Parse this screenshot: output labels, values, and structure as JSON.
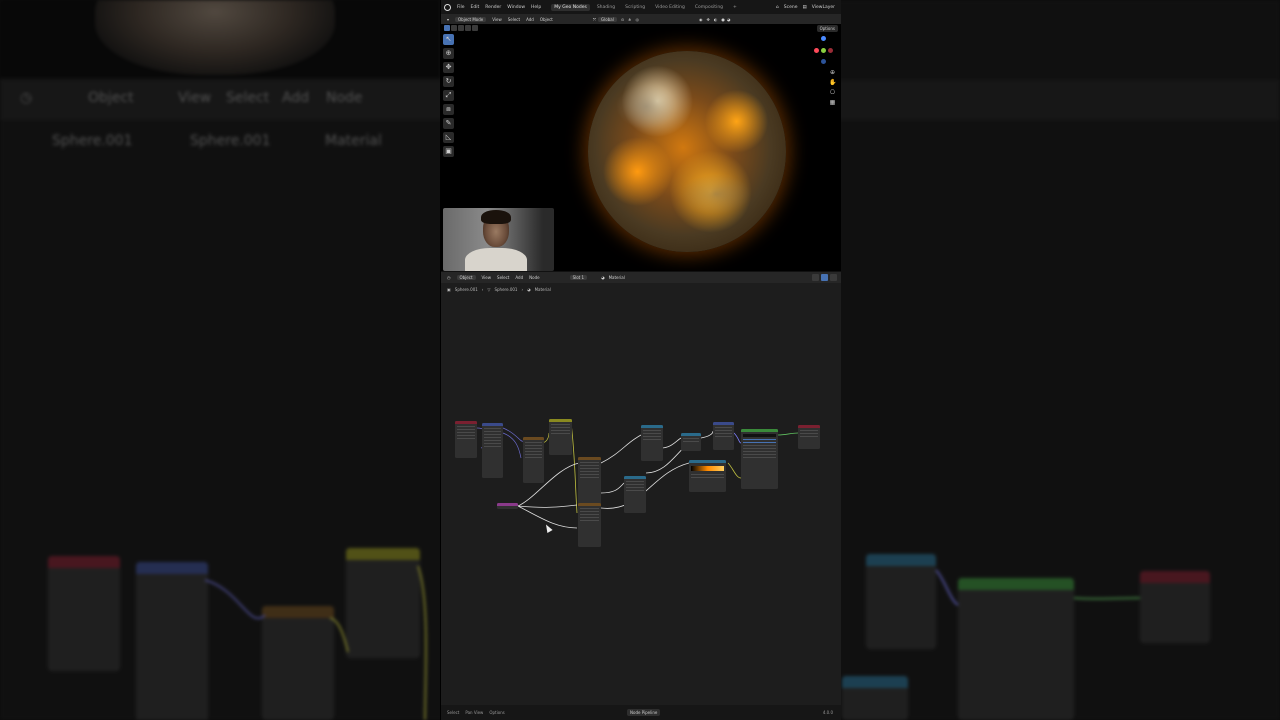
{
  "topbar": {
    "menus": [
      "File",
      "Edit",
      "Render",
      "Window",
      "Help"
    ],
    "workspaces": [
      {
        "label": "My Geo Nodes",
        "active": true
      },
      {
        "label": "Shading",
        "active": false
      },
      {
        "label": "Scripting",
        "active": false
      },
      {
        "label": "Video Editing",
        "active": false
      },
      {
        "label": "Compositing",
        "active": false
      }
    ],
    "scene": "Scene",
    "view_layer": "ViewLayer"
  },
  "viewport_header": {
    "mode": "Object Mode",
    "menus": [
      "View",
      "Select",
      "Add",
      "Object"
    ],
    "orientation": "Global",
    "options": "Options"
  },
  "node_editor_header": {
    "type": "Object",
    "menus": [
      "View",
      "Select",
      "Add",
      "Node"
    ],
    "slot": "Slot 1",
    "material": "Material"
  },
  "breadcrumb": {
    "object": "Sphere.001",
    "mesh": "Sphere.001",
    "material": "Material"
  },
  "statusbar": {
    "select": "Select",
    "pan": "Pan View",
    "options": "Options",
    "mode": "Node Pipeline",
    "version": "4.0.0"
  },
  "background": {
    "header_mode": "Object",
    "menus": [
      "View",
      "Select",
      "Add",
      "Node"
    ],
    "crumbs": [
      "Sphere.001",
      "Sphere.001",
      "Material"
    ]
  },
  "colors": {
    "accent": "#4772b3",
    "panel": "#1d1d1d",
    "header": "#262626",
    "node_body": "#303030",
    "node_input": "#7a2030",
    "node_vector": "#3a4a8a",
    "node_texture": "#6a4a20",
    "node_converter": "#2a6a8a",
    "node_shader": "#3a8a3a",
    "node_color": "#8a8a20",
    "node_group": "#8a3a8a"
  }
}
